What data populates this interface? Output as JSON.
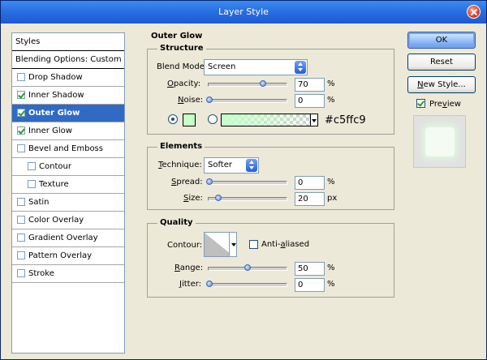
{
  "window": {
    "title": "Layer Style"
  },
  "styles": {
    "header": "Styles",
    "blending": "Blending Options: Custom",
    "items": [
      {
        "label": "Drop Shadow",
        "checked": false,
        "sub": false,
        "active": false
      },
      {
        "label": "Inner Shadow",
        "checked": true,
        "sub": false,
        "active": false
      },
      {
        "label": "Outer Glow",
        "checked": true,
        "sub": false,
        "active": true
      },
      {
        "label": "Inner Glow",
        "checked": true,
        "sub": false,
        "active": false
      },
      {
        "label": "Bevel and Emboss",
        "checked": false,
        "sub": false,
        "active": false
      },
      {
        "label": "Contour",
        "checked": false,
        "sub": true,
        "active": false
      },
      {
        "label": "Texture",
        "checked": false,
        "sub": true,
        "active": false
      },
      {
        "label": "Satin",
        "checked": false,
        "sub": false,
        "active": false
      },
      {
        "label": "Color Overlay",
        "checked": false,
        "sub": false,
        "active": false
      },
      {
        "label": "Gradient Overlay",
        "checked": false,
        "sub": false,
        "active": false
      },
      {
        "label": "Pattern Overlay",
        "checked": false,
        "sub": false,
        "active": false
      },
      {
        "label": "Stroke",
        "checked": false,
        "sub": false,
        "active": false
      }
    ]
  },
  "outer_glow": {
    "title": "Outer Glow",
    "structure": {
      "title": "Structure",
      "blend_mode_label": "Blend Mode:",
      "blend_mode_value": "Screen",
      "opacity_label": "Opacity:",
      "opacity_value": "70",
      "noise_label": "Noise:",
      "noise_value": "0",
      "percent": "%",
      "color_hex": "#c5ffc9",
      "color": "#c5ffc9"
    },
    "elements": {
      "title": "Elements",
      "technique_label": "Technique:",
      "technique_value": "Softer",
      "spread_label": "Spread:",
      "spread_value": "0",
      "size_label": "Size:",
      "size_value": "20",
      "percent": "%",
      "px": "px"
    },
    "quality": {
      "title": "Quality",
      "contour_label": "Contour:",
      "anti_aliased_label": "Anti-aliased",
      "range_label": "Range:",
      "range_value": "50",
      "jitter_label": "Jitter:",
      "jitter_value": "0",
      "percent": "%"
    }
  },
  "buttons": {
    "ok": "OK",
    "reset": "Reset",
    "new_style": "New Style...",
    "preview": "Preview"
  },
  "colors": {
    "titlebar": "#2a6fe0",
    "selection": "#316ac5",
    "glow": "#c5ffc9"
  }
}
